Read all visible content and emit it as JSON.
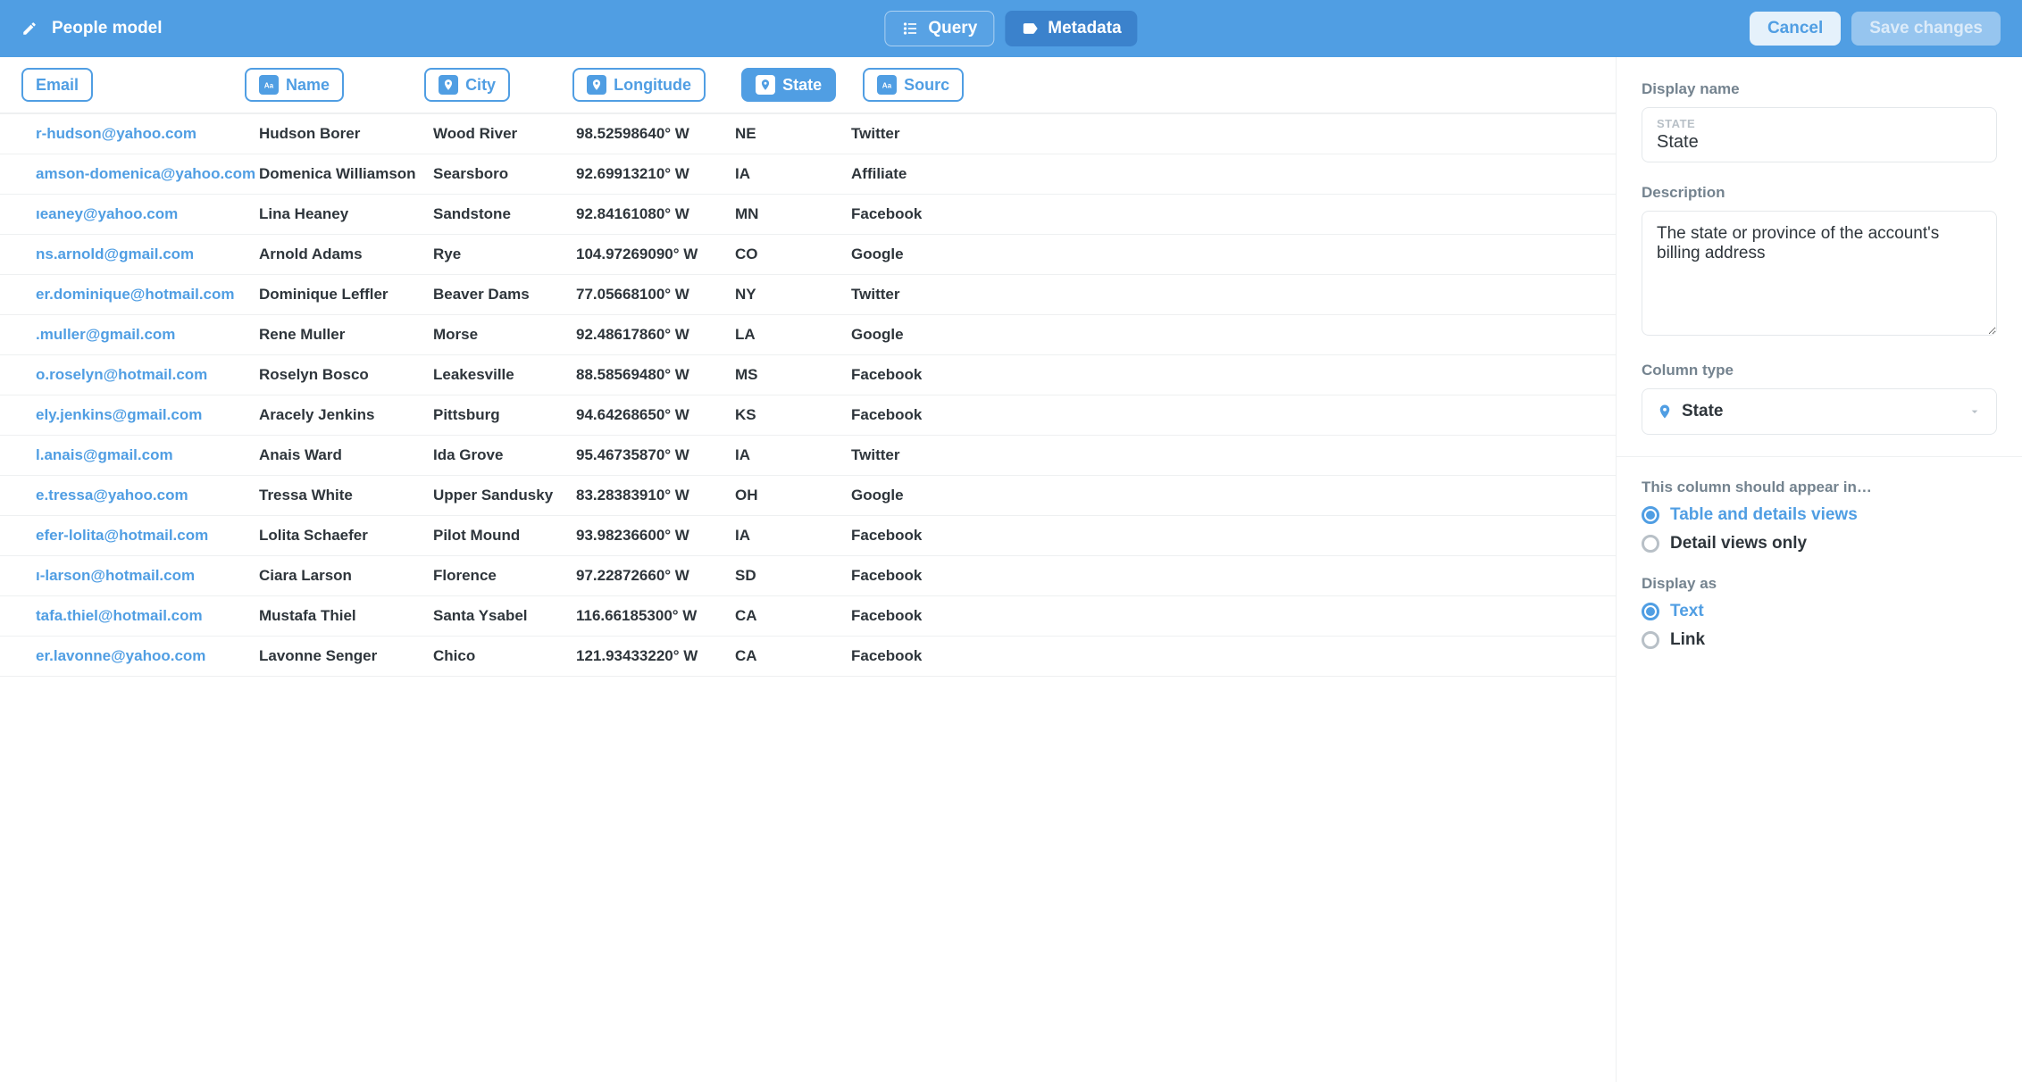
{
  "header": {
    "title": "People model",
    "query_btn": "Query",
    "metadata_btn": "Metadata",
    "cancel_btn": "Cancel",
    "save_btn": "Save changes"
  },
  "columns": {
    "email": "Email",
    "name": "Name",
    "city": "City",
    "longitude": "Longitude",
    "state": "State",
    "source": "Sourc"
  },
  "rows": [
    {
      "email": "r-hudson@yahoo.com",
      "name": "Hudson Borer",
      "city": "Wood River",
      "long": "98.52598640° W",
      "state": "NE",
      "source": "Twitter"
    },
    {
      "email": "amson-domenica@yahoo.com",
      "name": "Domenica Williamson",
      "city": "Searsboro",
      "long": "92.69913210° W",
      "state": "IA",
      "source": "Affiliate"
    },
    {
      "email": "ıeaney@yahoo.com",
      "name": "Lina Heaney",
      "city": "Sandstone",
      "long": "92.84161080° W",
      "state": "MN",
      "source": "Facebook"
    },
    {
      "email": "ns.arnold@gmail.com",
      "name": "Arnold Adams",
      "city": "Rye",
      "long": "104.97269090° W",
      "state": "CO",
      "source": "Google"
    },
    {
      "email": "er.dominique@hotmail.com",
      "name": "Dominique Leffler",
      "city": "Beaver Dams",
      "long": "77.05668100° W",
      "state": "NY",
      "source": "Twitter"
    },
    {
      "email": ".muller@gmail.com",
      "name": "Rene Muller",
      "city": "Morse",
      "long": "92.48617860° W",
      "state": "LA",
      "source": "Google"
    },
    {
      "email": "o.roselyn@hotmail.com",
      "name": "Roselyn Bosco",
      "city": "Leakesville",
      "long": "88.58569480° W",
      "state": "MS",
      "source": "Facebook"
    },
    {
      "email": "ely.jenkins@gmail.com",
      "name": "Aracely Jenkins",
      "city": "Pittsburg",
      "long": "94.64268650° W",
      "state": "KS",
      "source": "Facebook"
    },
    {
      "email": "l.anais@gmail.com",
      "name": "Anais Ward",
      "city": "Ida Grove",
      "long": "95.46735870° W",
      "state": "IA",
      "source": "Twitter"
    },
    {
      "email": "e.tressa@yahoo.com",
      "name": "Tressa White",
      "city": "Upper Sandusky",
      "long": "83.28383910° W",
      "state": "OH",
      "source": "Google"
    },
    {
      "email": "efer-lolita@hotmail.com",
      "name": "Lolita Schaefer",
      "city": "Pilot Mound",
      "long": "93.98236600° W",
      "state": "IA",
      "source": "Facebook"
    },
    {
      "email": "ı-larson@hotmail.com",
      "name": "Ciara Larson",
      "city": "Florence",
      "long": "97.22872660° W",
      "state": "SD",
      "source": "Facebook"
    },
    {
      "email": "tafa.thiel@hotmail.com",
      "name": "Mustafa Thiel",
      "city": "Santa Ysabel",
      "long": "116.66185300° W",
      "state": "CA",
      "source": "Facebook"
    },
    {
      "email": "er.lavonne@yahoo.com",
      "name": "Lavonne Senger",
      "city": "Chico",
      "long": "121.93433220° W",
      "state": "CA",
      "source": "Facebook"
    }
  ],
  "sidebar": {
    "display_name_label": "Display name",
    "display_name_caption": "STATE",
    "display_name_value": "State",
    "description_label": "Description",
    "description_value": "The state or province of the account's billing address",
    "column_type_label": "Column type",
    "column_type_value": "State",
    "appear_label": "This column should appear in…",
    "appear_opt1": "Table and details views",
    "appear_opt2": "Detail views only",
    "display_as_label": "Display as",
    "display_as_opt1": "Text",
    "display_as_opt2": "Link"
  }
}
